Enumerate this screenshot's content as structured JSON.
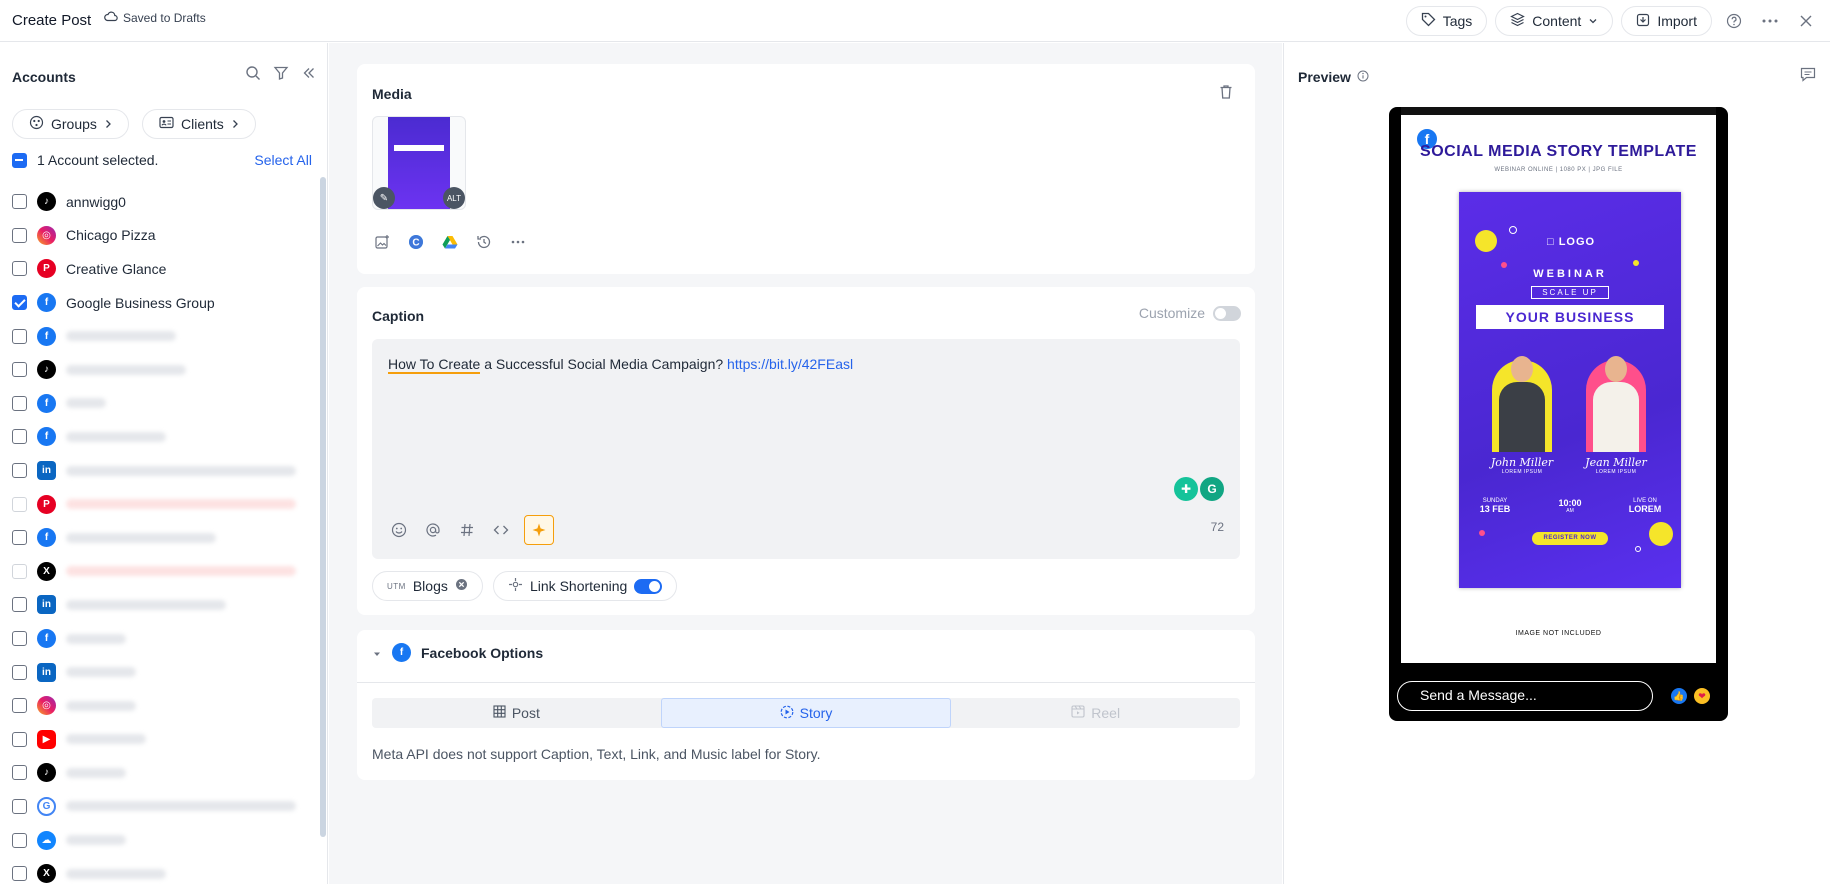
{
  "header": {
    "title": "Create Post",
    "draft_status": "Saved to Drafts",
    "tags_label": "Tags",
    "content_label": "Content",
    "import_label": "Import"
  },
  "sidebar": {
    "title": "Accounts",
    "groups_label": "Groups",
    "clients_label": "Clients",
    "selected_text": "1 Account selected.",
    "select_all_label": "Select All",
    "accounts": [
      {
        "name": "annwigg0",
        "network": "tiktok",
        "checked": false
      },
      {
        "name": "Chicago Pizza",
        "network": "instagram",
        "checked": false
      },
      {
        "name": "Creative Glance",
        "network": "pinterest",
        "checked": false
      },
      {
        "name": "Google Business Group",
        "network": "facebook",
        "checked": true
      }
    ],
    "hidden_account_networks": [
      "facebook",
      "tiktok",
      "facebook",
      "facebook",
      "linkedin",
      "pinterest",
      "facebook",
      "x",
      "linkedin",
      "facebook",
      "linkedin",
      "instagram",
      "youtube",
      "tiktok",
      "google",
      "bluesky",
      "x"
    ]
  },
  "media": {
    "title": "Media",
    "alt_badge": "ALT"
  },
  "caption": {
    "title": "Caption",
    "customize_label": "Customize",
    "text_underlined": "How To Create",
    "text_rest": " a Successful Social Media Campaign? ",
    "link": "https://bit.ly/42FEasl",
    "char_count": "72",
    "utm_prefix": "UTM",
    "utm_label": "Blogs",
    "link_shortening_label": "Link Shortening"
  },
  "facebook_options": {
    "title": "Facebook Options",
    "tabs": [
      {
        "label": "Post",
        "state": "normal"
      },
      {
        "label": "Story",
        "state": "active"
      },
      {
        "label": "Reel",
        "state": "disabled"
      }
    ],
    "note": "Meta API does not support Caption, Text, Link, and Music label for Story."
  },
  "preview": {
    "title": "Preview",
    "story_title": "SOCIAL MEDIA STORY TEMPLATE",
    "story_sub": "WEBINAR ONLINE  |  1080 PX  |  JPG FILE",
    "poster": {
      "logo": "LOGO",
      "webinar": "WEBINAR",
      "scale_up": "SCALE UP",
      "business": "YOUR BUSINESS",
      "person1_name": "John Miller",
      "person1_sub": "LOREM IPSUM",
      "person2_name": "Jean Miller",
      "person2_sub": "LOREM IPSUM",
      "date_a": "SUNDAY",
      "date_b": "13 FEB",
      "time_a": "10:00",
      "time_b": "AM",
      "live_a": "LIVE ON",
      "live_b": "LOREM",
      "register": "REGISTER NOW"
    },
    "image_note": "IMAGE NOT INCLUDED",
    "message_placeholder": "Send a Message..."
  },
  "colors": {
    "accent": "#1d6bf3",
    "link": "#2563eb",
    "ai_accent": "#f59e0b",
    "poster_purple": "#4a27d1"
  }
}
